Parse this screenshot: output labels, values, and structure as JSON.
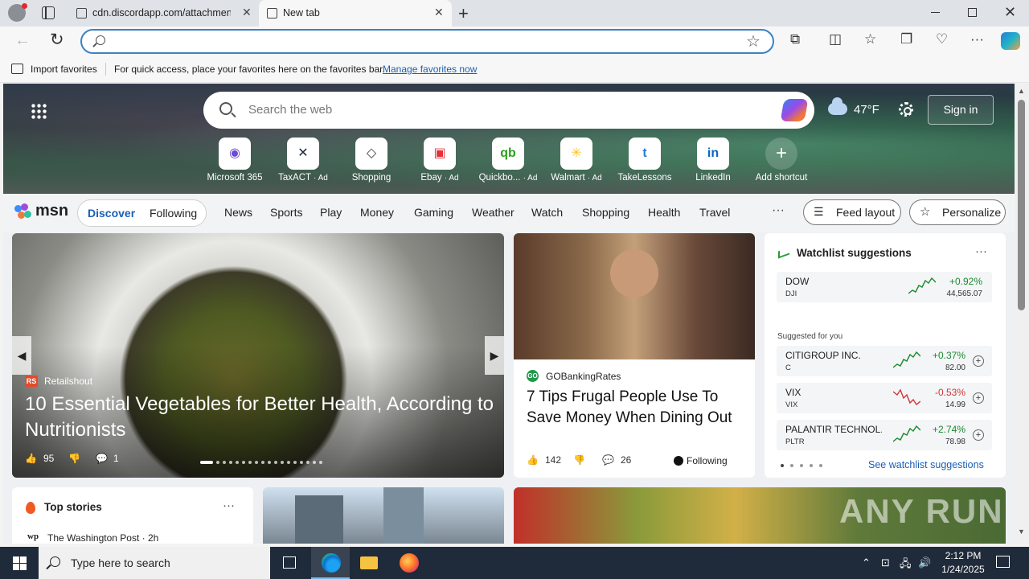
{
  "browser": {
    "tabs": [
      {
        "title": "cdn.discordapp.com/attachments/"
      },
      {
        "title": "New tab"
      }
    ],
    "address_value": "",
    "favorites_bar": {
      "import_label": "Import favorites",
      "message": "For quick access, place your favorites here on the favorites bar.",
      "manage_link": "Manage favorites now"
    }
  },
  "newtab": {
    "search_placeholder": "Search the web",
    "weather": {
      "temp": "47°F",
      "icon": "partly-cloudy-icon"
    },
    "signin_label": "Sign in",
    "shortcuts": [
      {
        "label": "Microsoft 365",
        "ad": "",
        "glyph": "◉",
        "color": "#6a4ad6"
      },
      {
        "label": "TaxACT",
        "ad": "· Ad",
        "glyph": "✕",
        "color": "#1a2a3a"
      },
      {
        "label": "Shopping",
        "ad": "",
        "glyph": "◇",
        "color": "#444444"
      },
      {
        "label": "Ebay",
        "ad": "· Ad",
        "glyph": "▣",
        "color": "#e53238"
      },
      {
        "label": "Quickbo...",
        "ad": "· Ad",
        "glyph": "qb",
        "color": "#2ca01c"
      },
      {
        "label": "Walmart",
        "ad": "· Ad",
        "glyph": "✳",
        "color": "#ffc220"
      },
      {
        "label": "TakeLessons",
        "ad": "",
        "glyph": "t",
        "color": "#2a7bd6"
      },
      {
        "label": "LinkedIn",
        "ad": "",
        "glyph": "in",
        "color": "#0a66c2"
      },
      {
        "label": "Add shortcut",
        "ad": "",
        "glyph": "+",
        "color": "#ffffff"
      }
    ]
  },
  "msn": {
    "logo_text": "msn",
    "pill": {
      "discover": "Discover",
      "following": "Following"
    },
    "nav": [
      "News",
      "Sports",
      "Play",
      "Money",
      "Gaming",
      "Weather",
      "Watch",
      "Shopping",
      "Health",
      "Travel"
    ],
    "more": "···",
    "feed_layout": "Feed layout",
    "personalize": "Personalize",
    "hero": {
      "source_badge": "RS",
      "source": "Retailshout",
      "title": "10 Essential Vegetables for Better Health, According to Nutritionists",
      "likes": "95",
      "comments": "1"
    },
    "article": {
      "source_badge": "GO",
      "source": "GOBankingRates",
      "title": "7 Tips Frugal People Use To Save Money When Dining Out",
      "likes": "142",
      "comments": "26",
      "follow": "Following"
    },
    "watchlist": {
      "title": "Watchlist suggestions",
      "more": "···",
      "main": {
        "name": "DOW",
        "symbol": "DJI",
        "change": "+0.92%",
        "price": "44,565.07",
        "trend": "up"
      },
      "suggested_label": "Suggested for you",
      "items": [
        {
          "name": "CITIGROUP INC.",
          "symbol": "C",
          "change": "+0.37%",
          "price": "82.00",
          "trend": "up"
        },
        {
          "name": "VIX",
          "symbol": "VIX",
          "change": "-0.53%",
          "price": "14.99",
          "trend": "down"
        },
        {
          "name": "PALANTIR TECHNOL...",
          "symbol": "PLTR",
          "change": "+2.74%",
          "price": "78.98",
          "trend": "up"
        }
      ],
      "link": "See watchlist suggestions",
      "colors": {
        "up": "#1a8a2e",
        "down": "#d13438"
      }
    },
    "top_stories": {
      "title": "Top stories",
      "more": "···",
      "source_badge": "wp",
      "source": "The Washington Post · 2h"
    },
    "watermark": "ANY RUN"
  },
  "taskbar": {
    "search_placeholder": "Type here to search",
    "time": "2:12 PM",
    "date": "1/24/2025"
  }
}
